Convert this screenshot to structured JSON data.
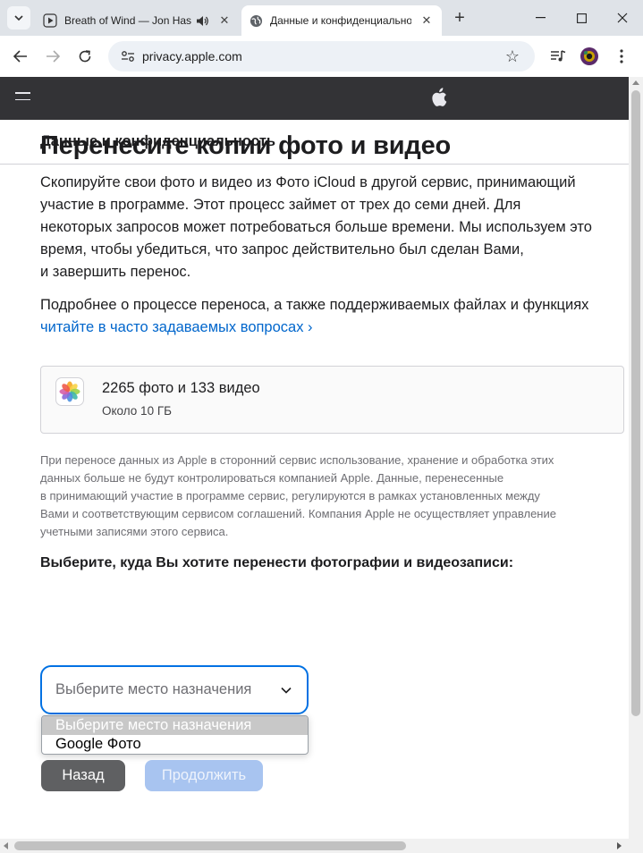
{
  "browser": {
    "tabs": [
      {
        "title": "Breath of Wind — Jon Hassell",
        "active": false,
        "audio": true
      },
      {
        "title": "Данные и конфиденциальность",
        "active": true,
        "audio": false
      }
    ],
    "address": "privacy.apple.com",
    "new_tab_symbol": "+",
    "icons": [
      "tab-search-icon",
      "play-favicon-icon",
      "speaker-icon",
      "close-icon",
      "globe-favicon-icon",
      "plus-icon",
      "minimize-icon",
      "maximize-icon",
      "back-arrow-icon",
      "forward-arrow-icon",
      "reload-icon",
      "site-settings-icon",
      "star-icon",
      "media-queue-icon",
      "profile-avatar-icon",
      "kebab-menu-icon"
    ]
  },
  "site": {
    "nav_icons": [
      "menu-icon",
      "apple-logo-icon"
    ],
    "local_nav_title": "Данные и конфиденциальность"
  },
  "main": {
    "title": "Перенесите копии фото и видео",
    "intro_lines": [
      "Скопируйте свои фото и видео из Фото iCloud в другой сервис, принимающий",
      "участие в программе. Этот процесс займет от трех до семи дней. Для",
      "некоторых запросов может потребоваться больше времени. Мы используем это",
      "время, чтобы убедиться, что запрос действительно был сделан Вами,",
      "и завершить перенос."
    ],
    "more_info_text": "Подробнее о процессе переноса, а также поддерживаемых файлах и функциях",
    "faq_link": "читайте в часто задаваемых вопросах ›",
    "summary": {
      "icon": "photos-app-icon",
      "count": "2265 фото и 133 видео",
      "size": "Около 10 ГБ"
    },
    "disclaimer_lines": [
      "При переносе данных из Apple в сторонний сервис использование, хранение и обработка этих",
      "данных больше не будут контролироваться компанией Apple. Данные, перенесенные",
      "в принимающий участие в программе сервис, регулируются в рамках установленных между",
      "Вами и соответствующим сервисом соглашений. Компания Apple не осуществляет управление",
      "учетными записями этого сервиса."
    ],
    "destination_label": "Выберите, куда Вы хотите перенести фотографии и видеозаписи:",
    "destination_select": {
      "value": "Выберите место назначения",
      "options": [
        "Выберите место назначения",
        "Google Фото"
      ],
      "selected_index": 0
    },
    "back_button": "Назад",
    "continue_button": "Продолжить"
  },
  "colors": {
    "accent": "#0071e3",
    "link": "#0066cc",
    "global_nav_bg": "#333336",
    "back_button_bg": "#5f6062",
    "continue_disabled_bg": "#a8c4f0"
  }
}
